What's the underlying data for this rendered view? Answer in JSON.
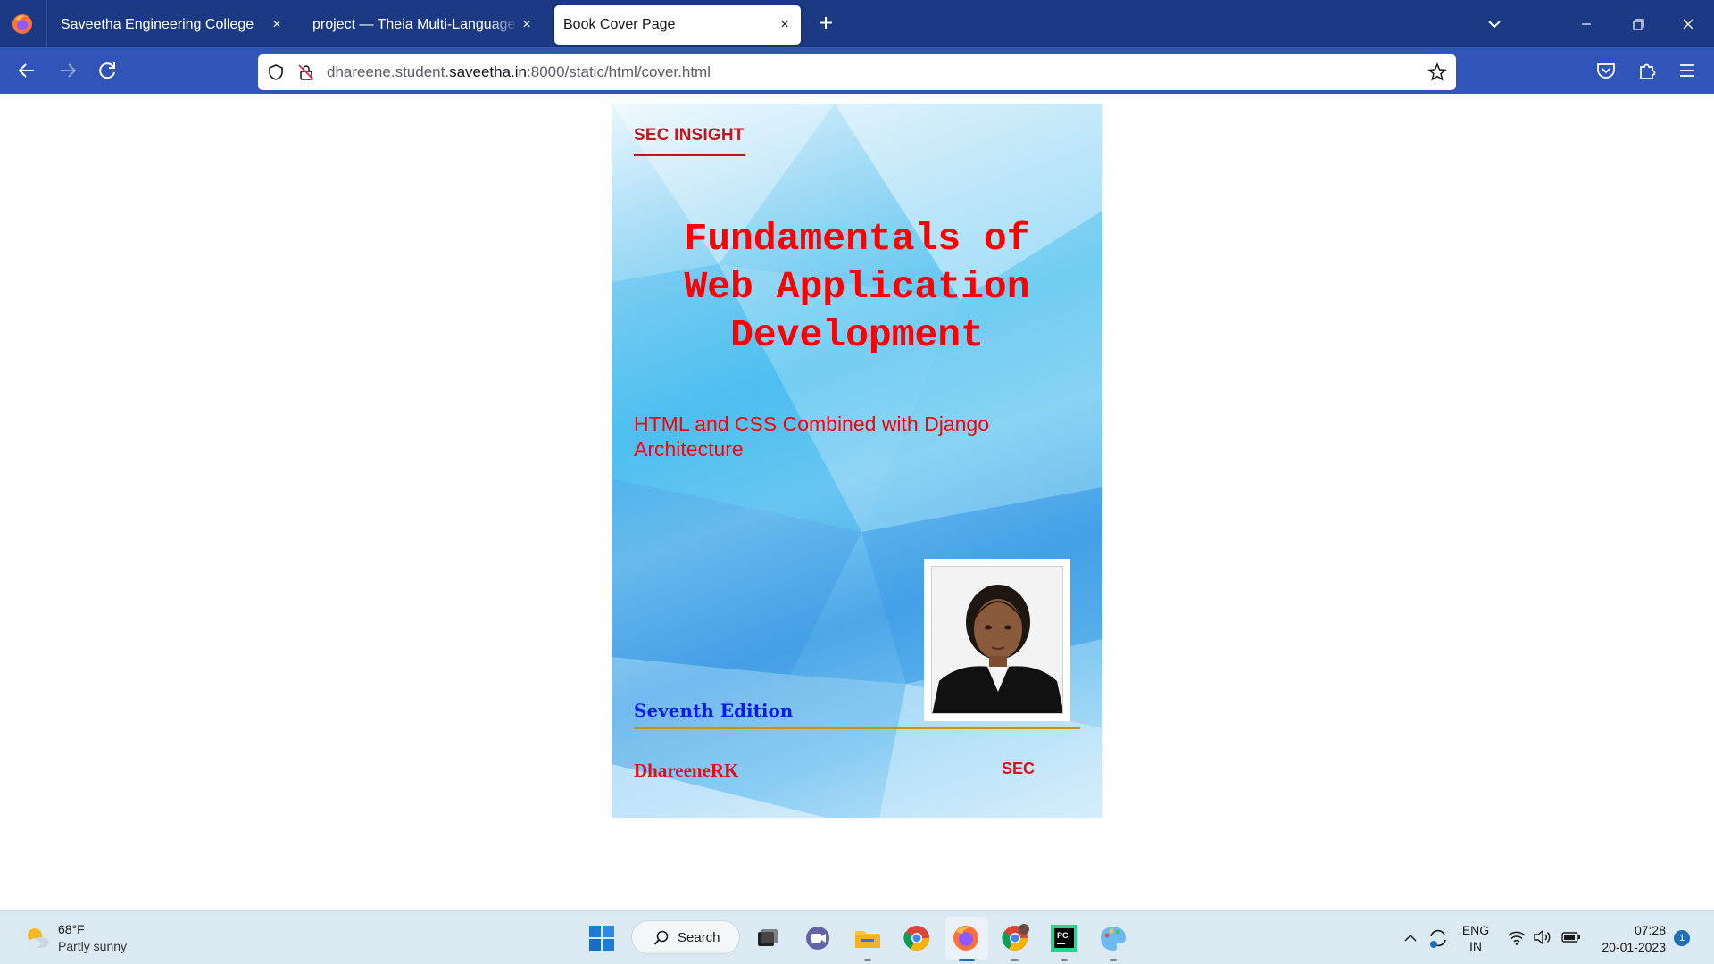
{
  "browser": {
    "tabs": [
      {
        "title": "Saveetha Engineering College",
        "active": false
      },
      {
        "title": "project — Theia Multi-Language Ex",
        "active": false
      },
      {
        "title": "Book Cover Page",
        "active": true
      }
    ],
    "close_glyph": "×",
    "new_tab_glyph": "+",
    "url": {
      "prefix": "dhareene.student.",
      "domain": "saveetha.in",
      "suffix": ":8000/static/html/cover.html"
    }
  },
  "cover": {
    "publisher": "SEC INSIGHT",
    "title_lines": [
      "Fundamentals of",
      "Web Application",
      "Development"
    ],
    "subtitle_lines": [
      "HTML and CSS Combined with Django",
      "Architecture"
    ],
    "edition": "Seventh Edition",
    "author": "DhareeneRK",
    "imprint": "SEC",
    "colors": {
      "title": "#ff0000",
      "edition": "#0a1be6",
      "rule": "#b59a1f"
    }
  },
  "taskbar": {
    "weather": {
      "temp": "68°F",
      "desc": "Partly sunny"
    },
    "search_label": "Search",
    "apps": [
      "start-icon",
      "task-view-icon",
      "chat-icon",
      "file-explorer-icon",
      "chrome-icon",
      "firefox-icon",
      "chrome-profile-icon",
      "pycharm-icon",
      "paint-icon"
    ],
    "tray": {
      "lang_line1": "ENG",
      "lang_line2": "IN",
      "time": "07:28",
      "date": "20-01-2023",
      "notification_count": "1"
    }
  }
}
